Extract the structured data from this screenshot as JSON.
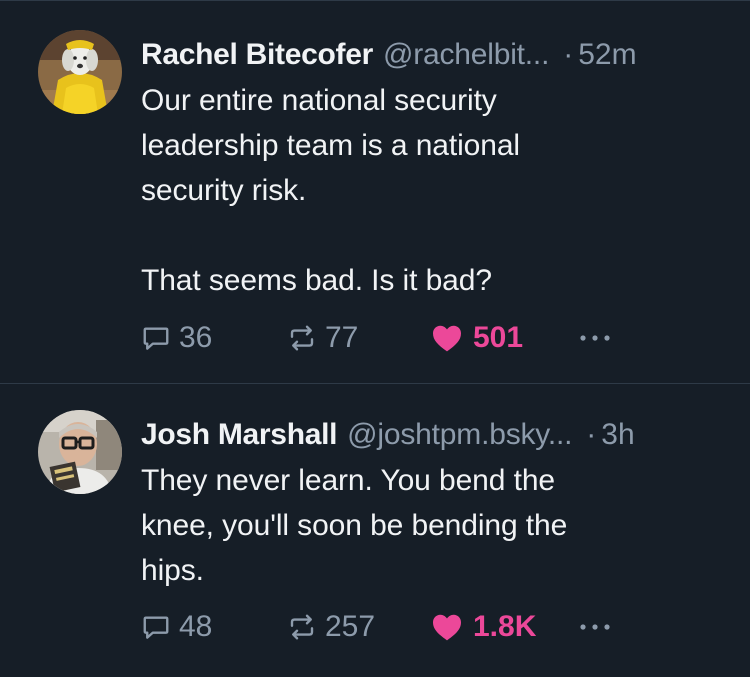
{
  "posts": [
    {
      "author_name": "Rachel Bitecofer",
      "handle": "@rachelbit...",
      "time_sep": "·",
      "time": "52m",
      "text": "Our entire national security\nleadership team is a national\nsecurity risk.\n\nThat seems bad. Is it bad?",
      "replies": "36",
      "reposts": "77",
      "likes": "501",
      "liked": true,
      "avatar_icon": "dog-in-yellow-raincoat-avatar"
    },
    {
      "author_name": "Josh Marshall",
      "handle": "@joshtpm.bsky...",
      "time_sep": "·",
      "time": "3h",
      "text": "They never learn. You bend the\nknee, you'll soon be bending the\nhips.",
      "replies": "48",
      "reposts": "257",
      "likes": "1.8K",
      "liked": true,
      "avatar_icon": "man-with-glasses-avatar"
    }
  ],
  "icons": {
    "reply": "reply-bubble-icon",
    "repost": "repost-arrows-icon",
    "like": "heart-icon",
    "more": "more-dots-icon"
  },
  "colors": {
    "background": "#161e27",
    "text": "#f1f3f5",
    "muted": "#8d9bab",
    "like": "#ec4899",
    "divider": "#2e3a47"
  }
}
